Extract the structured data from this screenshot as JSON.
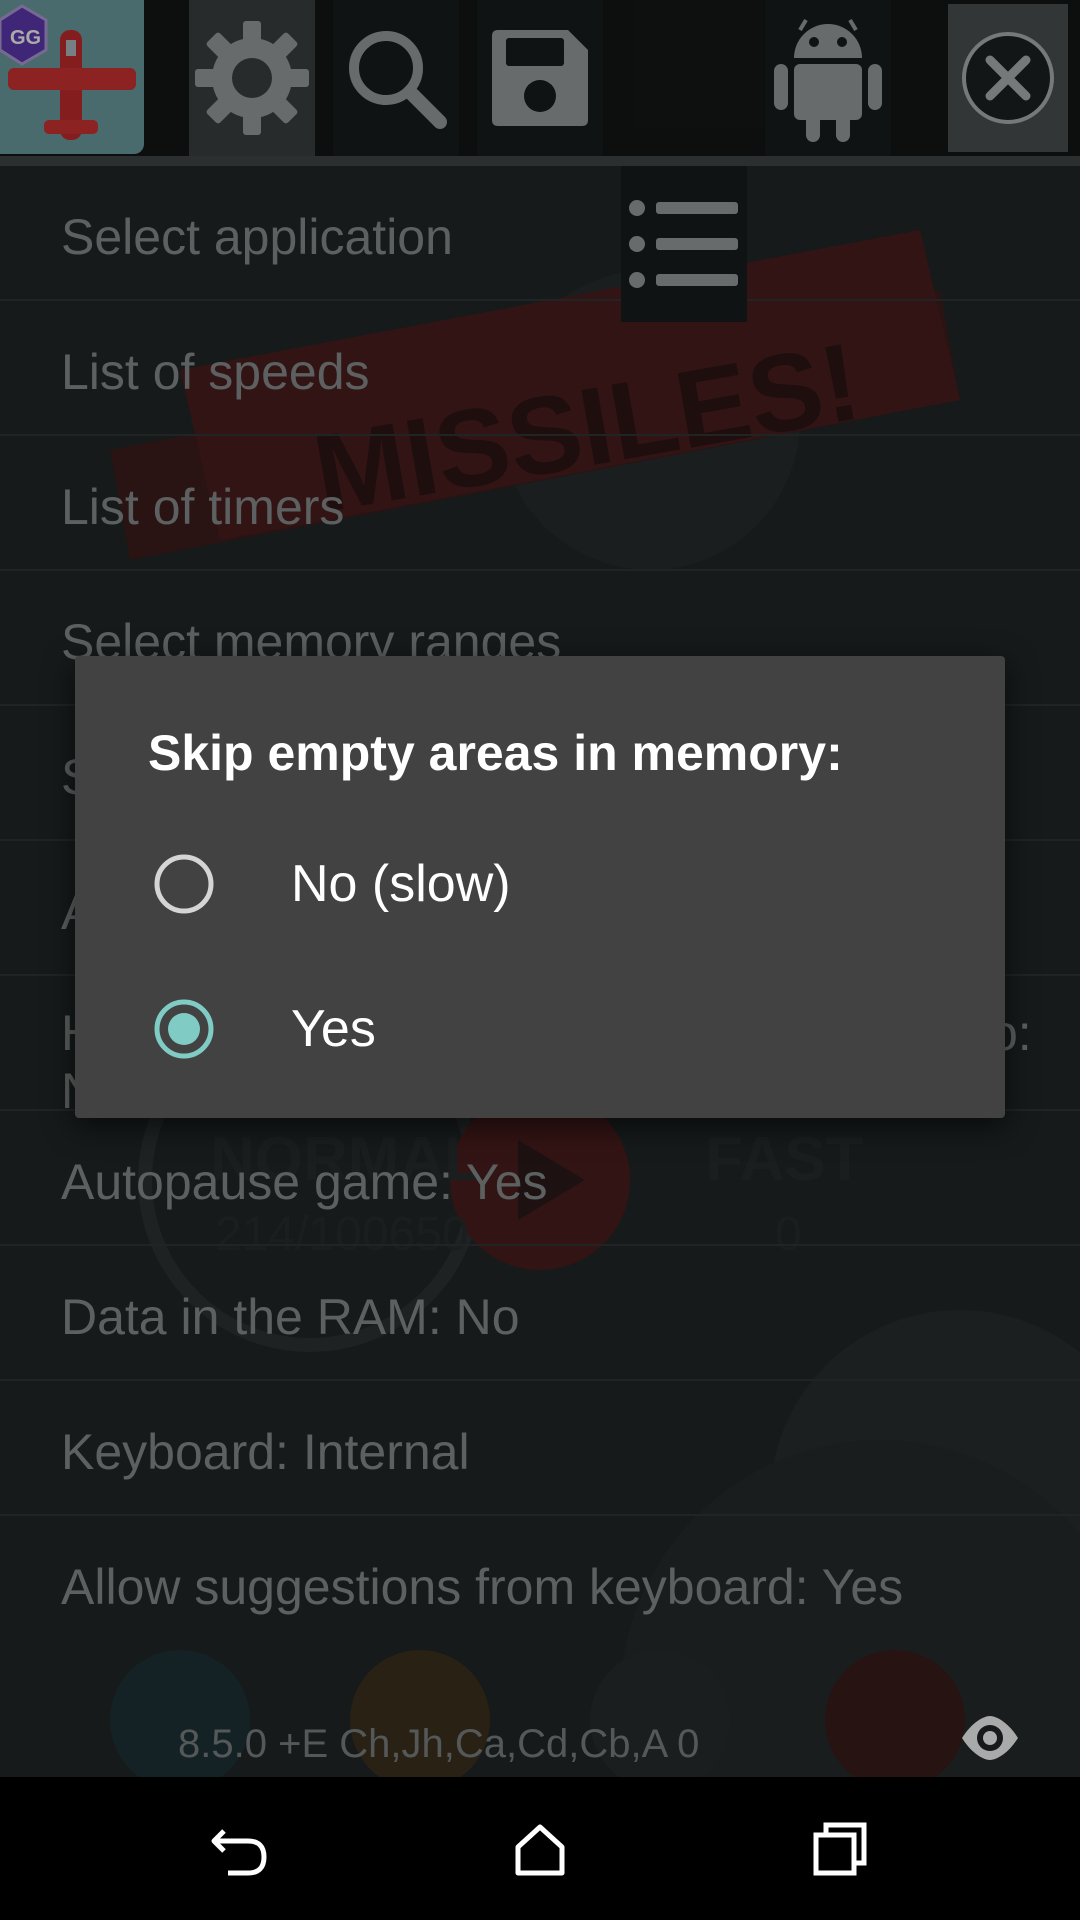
{
  "toolbar": {
    "app_icon": "plane-app-icon",
    "settings_icon": "gear-icon",
    "search_icon": "search-icon",
    "save_icon": "floppy-disk-icon",
    "list_icon": "list-icon",
    "android_icon": "android-icon",
    "close_icon": "close-icon"
  },
  "background": {
    "banner_text": "MISSILES!",
    "mode_normal": "NORMAL",
    "mode_fast": "FAST",
    "normal_score": "214/100650",
    "fast_score": "0"
  },
  "settings_list": [
    {
      "label": "Select application"
    },
    {
      "label": "List of speeds"
    },
    {
      "label": "List of timers"
    },
    {
      "label": "Select memory ranges"
    },
    {
      "label": "S"
    },
    {
      "label": "A"
    },
    {
      "label": "H",
      "label_line2": "No",
      "suffix": "o:"
    },
    {
      "label": "Autopause game: Yes"
    },
    {
      "label": "Data in the RAM: No"
    },
    {
      "label": "Keyboard: Internal"
    },
    {
      "label": "Allow suggestions from keyboard: Yes"
    }
  ],
  "footer": {
    "version_text": "8.5.0   +E Ch,Jh,Ca,Cd,Cb,A   0",
    "eye_icon": "eye-icon"
  },
  "dialog": {
    "title": "Skip empty areas in memory:",
    "options": [
      {
        "label": "No (slow)",
        "selected": false
      },
      {
        "label": "Yes",
        "selected": true
      }
    ],
    "accent_color": "#80cbc4"
  },
  "navbar": {
    "back_icon": "back-icon",
    "home_icon": "home-icon",
    "recents_icon": "recents-icon"
  }
}
